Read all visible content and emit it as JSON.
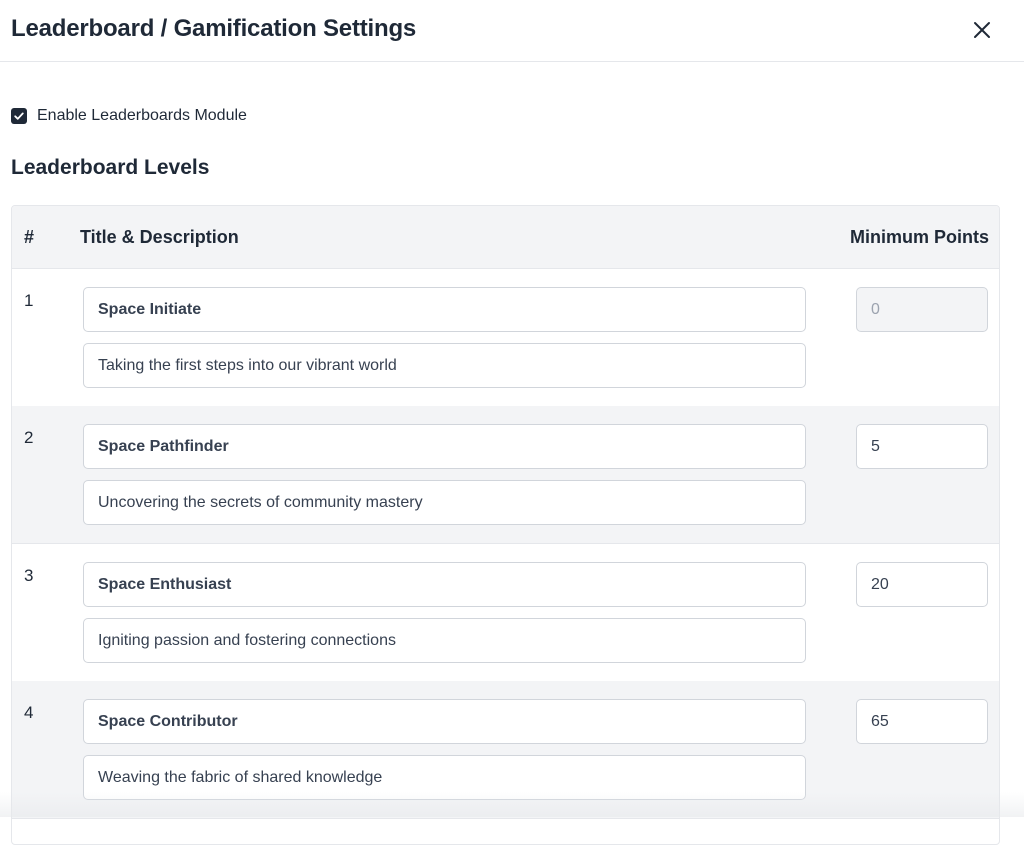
{
  "dialog": {
    "title": "Leaderboard / Gamification Settings",
    "close_icon": "close-icon"
  },
  "settings": {
    "enable_leaderboards_label": "Enable Leaderboards Module",
    "enable_leaderboards_checked": true
  },
  "levels_section": {
    "title": "Leaderboard Levels",
    "columns": [
      "#",
      "Title & Description",
      "Minimum Points"
    ],
    "rows": [
      {
        "number": "1",
        "title": "Space Initiate",
        "description": "Taking the first steps into our vibrant world",
        "min_points": "0",
        "points_disabled": true
      },
      {
        "number": "2",
        "title": "Space Pathfinder",
        "description": "Uncovering the secrets of community mastery",
        "min_points": "5",
        "points_disabled": false
      },
      {
        "number": "3",
        "title": "Space Enthusiast",
        "description": "Igniting passion and fostering connections",
        "min_points": "20",
        "points_disabled": false
      },
      {
        "number": "4",
        "title": "Space Contributor",
        "description": "Weaving the fabric of shared knowledge",
        "min_points": "65",
        "points_disabled": false
      }
    ]
  }
}
